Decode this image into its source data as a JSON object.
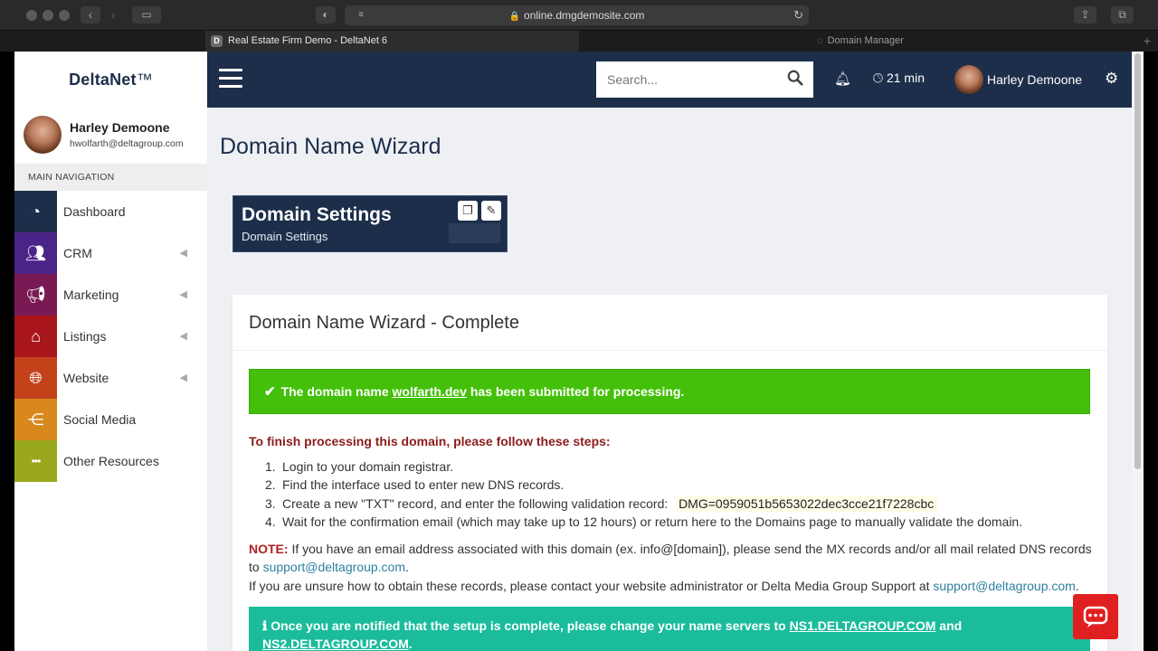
{
  "browser": {
    "url": "online.dmgdemosite.com",
    "active_tab": "Real Estate Firm Demo - DeltaNet 6",
    "active_tab_favicon": "D",
    "inactive_tab": "Domain Manager"
  },
  "sidebar": {
    "logo_bold": "DeltaNet",
    "logo_tm": "™",
    "user_name": "Harley Demoone",
    "user_email": "hwolfarth@deltagroup.com",
    "nav_header": "MAIN NAVIGATION",
    "items": [
      {
        "label": "Dashboard",
        "icon": "dashboard-gauge-icon",
        "color": "#1c2e4a",
        "has_chevron": false
      },
      {
        "label": "CRM",
        "icon": "users-icon",
        "color": "#4b2487",
        "has_chevron": true
      },
      {
        "label": "Marketing",
        "icon": "megaphone-icon",
        "color": "#7a1a54",
        "has_chevron": true
      },
      {
        "label": "Listings",
        "icon": "home-icon",
        "color": "#a8161b",
        "has_chevron": true
      },
      {
        "label": "Website",
        "icon": "globe-icon",
        "color": "#c4421a",
        "has_chevron": true
      },
      {
        "label": "Social Media",
        "icon": "share-icon",
        "color": "#d9881c",
        "has_chevron": false
      },
      {
        "label": "Other Resources",
        "icon": "more-dots-icon",
        "color": "#9aa81d",
        "has_chevron": false
      }
    ]
  },
  "topbar": {
    "search_placeholder": "Search...",
    "timer": "21 min",
    "user_name": "Harley Demoone",
    "bg_color": "#1c2e4a"
  },
  "page": {
    "title": "Domain Name Wizard",
    "card_title": "Domain Settings",
    "card_subtitle": "Domain Settings"
  },
  "panel": {
    "title": "Domain Name Wizard - Complete",
    "success_pre": "The domain name ",
    "success_domain": "wolfarth.dev",
    "success_post": " has been submitted for processing.",
    "steps_header": "To finish processing this domain, please follow these steps:",
    "steps": [
      {
        "num": "1.",
        "text": "Login to your domain registrar."
      },
      {
        "num": "2.",
        "text": "Find the interface used to enter new DNS records."
      },
      {
        "num": "3.",
        "text": "Create a new \"TXT\" record, and enter the following validation record:"
      },
      {
        "num": "4.",
        "text": "Wait for the confirmation email (which may take up to 12 hours) or return here to the Domains page to manually validate the domain."
      }
    ],
    "validation_record": "DMG=0959051b5653022dec3cce21f7228cbc",
    "note_label": "NOTE:",
    "note_text": " If you have an email address associated with this domain (ex. info@[domain]), please send the MX records and/or all mail related DNS records to ",
    "note_email": "support@deltagroup.com",
    "note_end": ".",
    "unsure_text": "If you are unsure how to obtain these records, please contact your website administrator or Delta Media Group Support at ",
    "unsure_email": "support@deltagroup.com",
    "unsure_end": ".",
    "info_pre": "Once you are notified that the setup is complete, please change your name servers to ",
    "ns1": "NS1.DELTAGROUP.COM",
    "info_and": " and ",
    "ns2": "NS2.DELTAGROUP.COM",
    "info_end": "."
  },
  "colors": {
    "success": "#44c00a",
    "info": "#1abc9c",
    "steps_header": "#8b1c1c",
    "note_label": "#b22020",
    "link": "#2f7fa0",
    "chat": "#e02020"
  }
}
